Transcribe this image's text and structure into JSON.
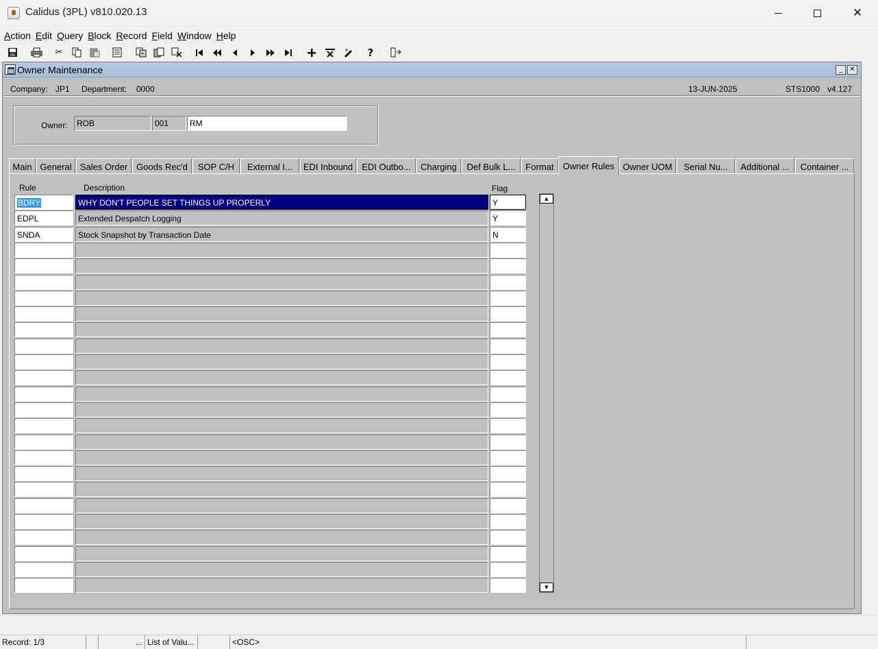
{
  "window": {
    "title": "Calidus (3PL) v810.020.13",
    "icon": "java-cup-icon"
  },
  "menu": [
    "Action",
    "Edit",
    "Query",
    "Block",
    "Record",
    "Field",
    "Window",
    "Help"
  ],
  "toolbar_icons": [
    "save-icon",
    "print-icon",
    "cut-icon",
    "copy-icon",
    "paste-icon",
    "list-icon",
    "duplicate-icon",
    "copy-record-icon",
    "clear-icon",
    "first-record-icon",
    "prev-block-icon",
    "prev-record-icon",
    "next-record-icon",
    "next-block-icon",
    "last-record-icon",
    "insert-icon",
    "delete-icon",
    "edit-icon",
    "help-icon",
    "exit-icon"
  ],
  "form": {
    "title": "Owner Maintenance",
    "company_label": "Company:",
    "company": "JP1",
    "department_label": "Department:",
    "department": "0000",
    "date": "13-JUN-2025",
    "program": "STS1000",
    "version": "v4.127"
  },
  "owner": {
    "label": "Owner:",
    "code": "ROB",
    "number": "001",
    "name": "RM"
  },
  "tabs": [
    {
      "label": "Main",
      "active": false
    },
    {
      "label": "General",
      "active": false
    },
    {
      "label": "Sales Order",
      "active": false
    },
    {
      "label": "Goods Rec'd",
      "active": false
    },
    {
      "label": "SOP C/H",
      "active": false
    },
    {
      "label": "External I...",
      "active": false
    },
    {
      "label": "EDI Inbound",
      "active": false
    },
    {
      "label": "EDI Outbo...",
      "active": false
    },
    {
      "label": "Charging",
      "active": false
    },
    {
      "label": "Def Bulk L...",
      "active": false
    },
    {
      "label": "Format",
      "active": false
    },
    {
      "label": "Owner Rules",
      "active": true
    },
    {
      "label": "Owner UOM",
      "active": false
    },
    {
      "label": "Serial Nu...",
      "active": false
    },
    {
      "label": "Additional ...",
      "active": false
    },
    {
      "label": "Container ...",
      "active": false
    }
  ],
  "grid": {
    "headers": {
      "rule": "Rule",
      "description": "Description",
      "flag": "Flag"
    },
    "rows": [
      {
        "rule": "BDRY",
        "description": "WHY DON'T PEOPLE SET THINGS UP PROPERLY",
        "flag": "Y"
      },
      {
        "rule": "EDPL",
        "description": "Extended Despatch Logging",
        "flag": "Y"
      },
      {
        "rule": "SNDA",
        "description": "Stock Snapshot by Transaction Date",
        "flag": "N"
      },
      {
        "rule": "",
        "description": "",
        "flag": ""
      },
      {
        "rule": "",
        "description": "",
        "flag": ""
      },
      {
        "rule": "",
        "description": "",
        "flag": ""
      },
      {
        "rule": "",
        "description": "",
        "flag": ""
      },
      {
        "rule": "",
        "description": "",
        "flag": ""
      },
      {
        "rule": "",
        "description": "",
        "flag": ""
      },
      {
        "rule": "",
        "description": "",
        "flag": ""
      },
      {
        "rule": "",
        "description": "",
        "flag": ""
      },
      {
        "rule": "",
        "description": "",
        "flag": ""
      },
      {
        "rule": "",
        "description": "",
        "flag": ""
      },
      {
        "rule": "",
        "description": "",
        "flag": ""
      },
      {
        "rule": "",
        "description": "",
        "flag": ""
      },
      {
        "rule": "",
        "description": "",
        "flag": ""
      },
      {
        "rule": "",
        "description": "",
        "flag": ""
      },
      {
        "rule": "",
        "description": "",
        "flag": ""
      },
      {
        "rule": "",
        "description": "",
        "flag": ""
      },
      {
        "rule": "",
        "description": "",
        "flag": ""
      },
      {
        "rule": "",
        "description": "",
        "flag": ""
      },
      {
        "rule": "",
        "description": "",
        "flag": ""
      },
      {
        "rule": "",
        "description": "",
        "flag": ""
      },
      {
        "rule": "",
        "description": "",
        "flag": ""
      },
      {
        "rule": "",
        "description": "",
        "flag": ""
      }
    ],
    "selected_row": 0
  },
  "status": {
    "record": "Record: 1/3",
    "dots": "...",
    "lov": "List of Valu...",
    "mode": "<OSC>"
  },
  "colors": {
    "form_bg": "#c0c0c0",
    "title_bar": "#a9bfdc",
    "selection": "#000080"
  }
}
